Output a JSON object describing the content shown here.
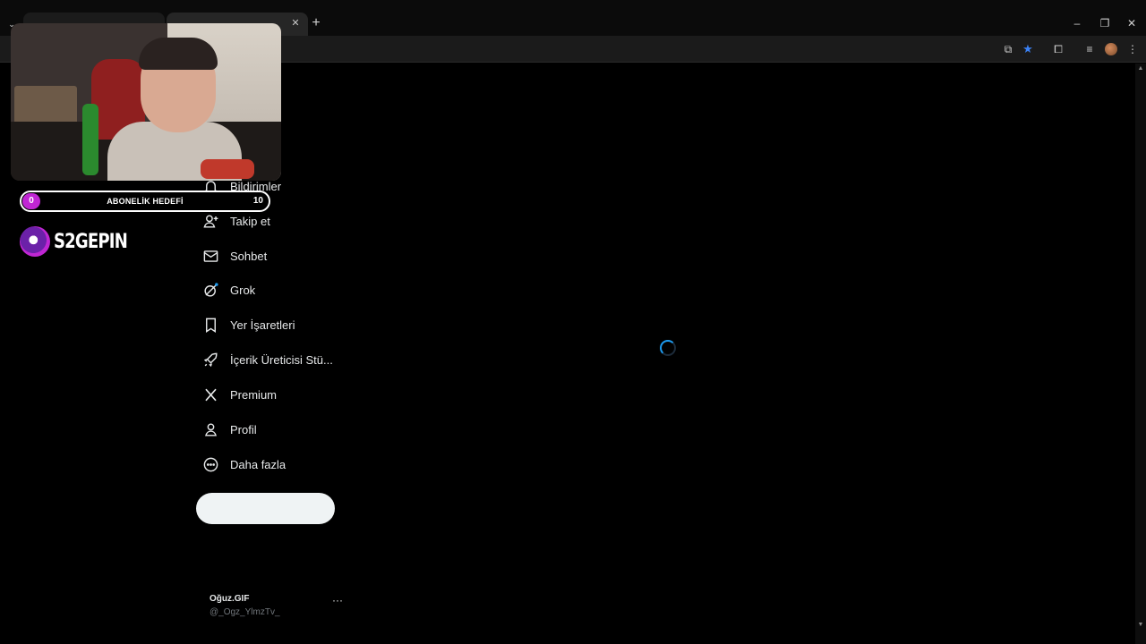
{
  "browser": {
    "icons": {
      "tab_search": "chevron-down-icon",
      "tab_close": "close-icon",
      "new_tab": "plus-icon",
      "minimize": "minimize-icon",
      "restore": "restore-icon",
      "close": "close-icon",
      "install": "install-app-icon",
      "bookmark": "star-icon",
      "extensions": "puzzle-icon",
      "media": "media-controls-icon",
      "profile": "avatar",
      "menu": "kebab-menu-icon"
    },
    "glyphs": {
      "tab_search": "⌄",
      "tab_close": "✕",
      "new_tab": "+",
      "minimize": "–",
      "restore": "❐",
      "close": "✕",
      "install": "⧉",
      "bookmark": "★",
      "extensions": "⧠",
      "media": "≡",
      "menu": "⋮",
      "scroll_up": "▲",
      "scroll_down": "▼"
    }
  },
  "sidebar": {
    "items": [
      {
        "label": "Bildirimler",
        "icon": "bell-icon"
      },
      {
        "label": "Takip et",
        "icon": "person-add-icon"
      },
      {
        "label": "Sohbet",
        "icon": "envelope-icon"
      },
      {
        "label": "Grok",
        "icon": "grok-icon"
      },
      {
        "label": "Yer İşaretleri",
        "icon": "bookmark-icon"
      },
      {
        "label": "İçerik Üreticisi Stü...",
        "icon": "rocket-icon"
      },
      {
        "label": "Premium",
        "icon": "x-logo-icon"
      },
      {
        "label": "Profil",
        "icon": "person-icon"
      },
      {
        "label": "Daha fazla",
        "icon": "more-circle-icon"
      }
    ],
    "post_button_label": ""
  },
  "account": {
    "name": "Oğuz.GIF",
    "handle": "@_Ogz_YlmzTv_",
    "more": "···"
  },
  "overlay": {
    "goal": {
      "current": "0",
      "label": "ABONELİK HEDEFİ",
      "target": "10"
    },
    "brand": "S2GEPIN"
  },
  "colors": {
    "accent": "#1d9bf0",
    "goal_dot": "#c026d3",
    "bookmark_star": "#3b82f6",
    "background": "#000000"
  }
}
